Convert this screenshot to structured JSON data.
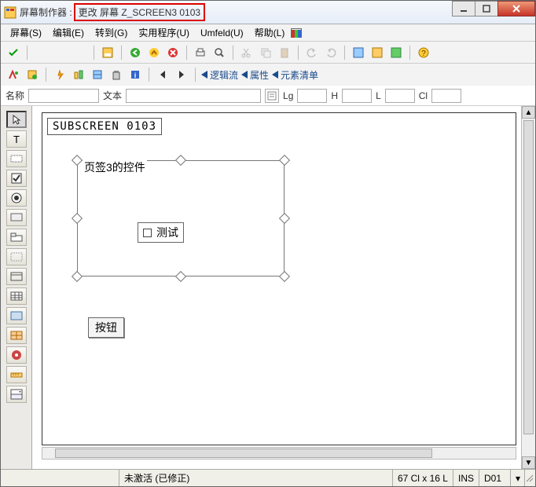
{
  "title": {
    "app": "屏幕制作器 :",
    "doc": "更改 屏幕 Z_SCREEN3 0103"
  },
  "menu": {
    "screen": "屏幕(S)",
    "edit": "编辑(E)",
    "goto": "转到(G)",
    "utilities": "实用程序(U)",
    "umfeld": "Umfeld(U)",
    "help": "帮助(L)"
  },
  "nav": {
    "logic": "逻辑流",
    "attrs": "属性",
    "elements": "元素清单"
  },
  "props": {
    "name_label": "名称",
    "text_label": "文本",
    "lg_label": "Lg",
    "h_label": "H",
    "l_label": "L",
    "cl_label": "Cl",
    "name_val": "",
    "text_val": "",
    "lg_val": "",
    "h_val": "",
    "l_val": "",
    "cl_val": ""
  },
  "canvas": {
    "subscreen": "SUBSCREEN 0103",
    "group_title": "页签3的控件",
    "checkbox_label": "测试",
    "button_label": "按钮"
  },
  "status": {
    "inactive": "未激活 (已修正)",
    "pos": "67 Cl x 16 L",
    "ins": "INS",
    "doc": "D01"
  }
}
